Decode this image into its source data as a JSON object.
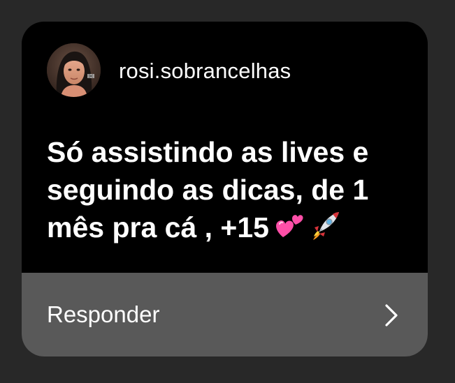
{
  "post": {
    "username": "rosi.sobrancelhas",
    "avatar_icon": "profile-photo",
    "message": "Só assistindo as lives e seguindo as dicas, de 1 mês pra cá , +15",
    "emojis": [
      "two-hearts-icon",
      "rocket-icon"
    ]
  },
  "reply": {
    "label": "Responder",
    "icon": "chevron-right-icon"
  },
  "colors": {
    "background": "#282828",
    "card": "#000000",
    "reply_bar": "#595959",
    "text": "#ffffff"
  }
}
